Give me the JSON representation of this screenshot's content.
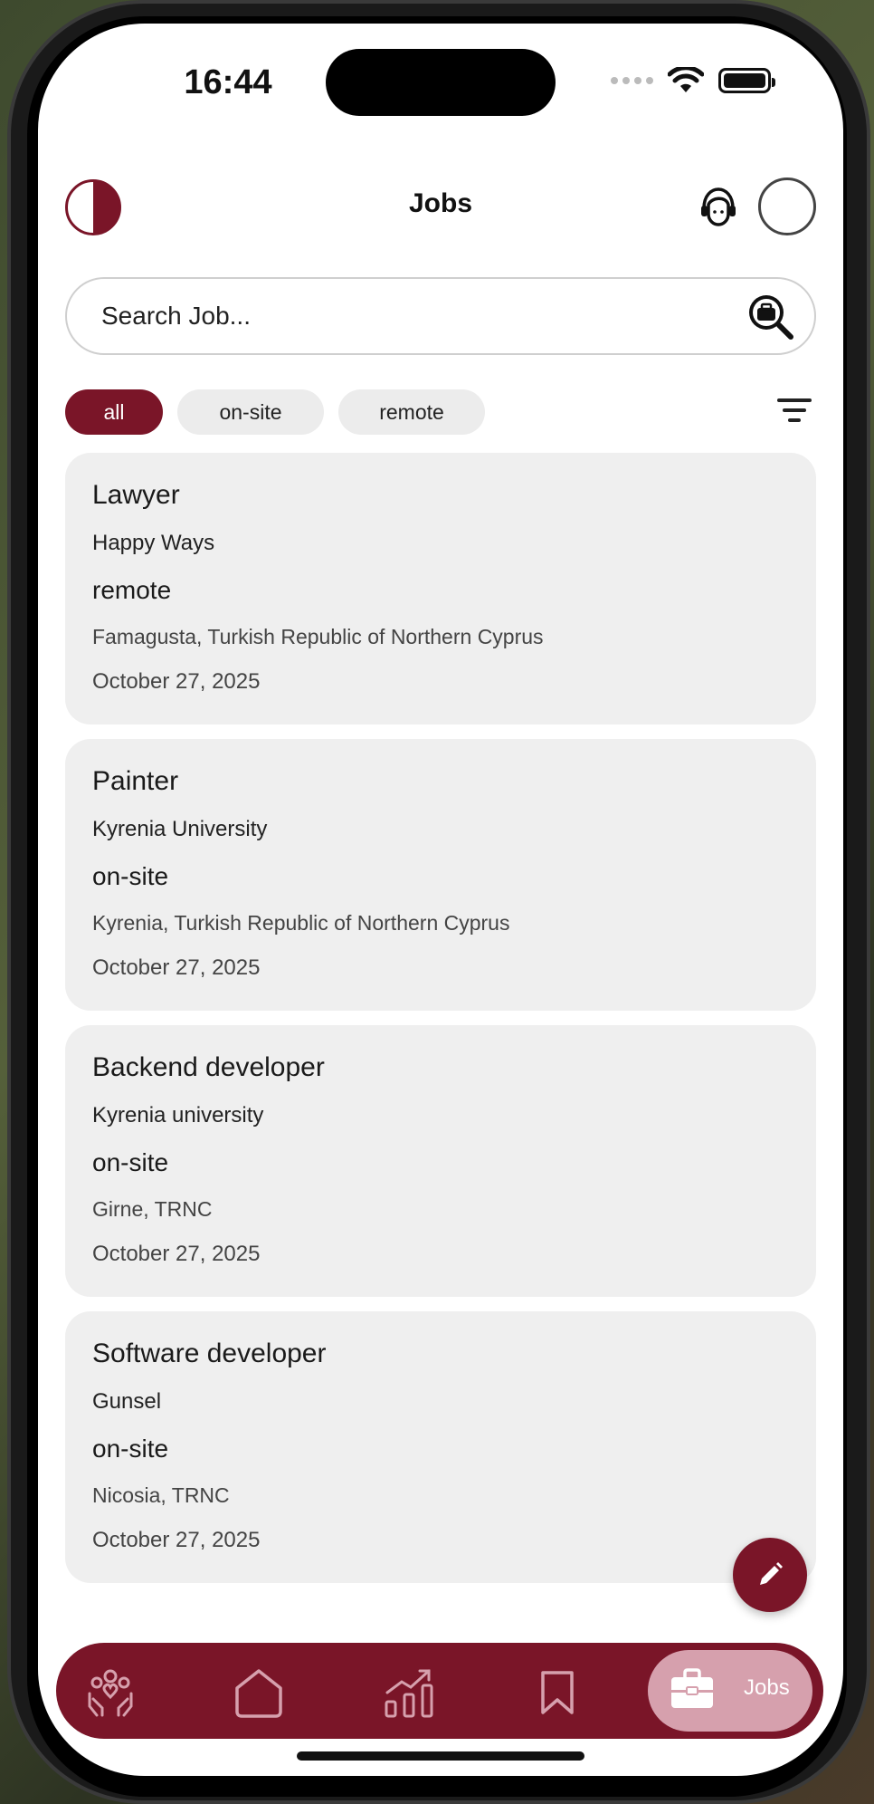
{
  "status_bar": {
    "time": "16:44"
  },
  "header": {
    "title": "Jobs"
  },
  "search": {
    "placeholder": "Search Job..."
  },
  "filters": [
    {
      "label": "all",
      "active": true
    },
    {
      "label": "on-site",
      "active": false
    },
    {
      "label": "remote",
      "active": false
    }
  ],
  "jobs": [
    {
      "title": "Lawyer",
      "company": "Happy Ways",
      "type": "remote",
      "location": "Famagusta, Turkish Republic of Northern Cyprus",
      "date": "October 27, 2025"
    },
    {
      "title": "Painter",
      "company": "Kyrenia University",
      "type": "on-site",
      "location": "Kyrenia, Turkish Republic of Northern Cyprus",
      "date": "October 27, 2025"
    },
    {
      "title": "Backend developer",
      "company": "Kyrenia university",
      "type": "on-site",
      "location": "Girne, TRNC",
      "date": "October 27, 2025"
    },
    {
      "title": "Software developer",
      "company": "Gunsel",
      "type": "on-site",
      "location": "Nicosia, TRNC",
      "date": "October 27, 2025"
    }
  ],
  "bottom_nav": {
    "items": [
      "community-icon",
      "home-icon",
      "stats-icon",
      "bookmark-icon",
      "briefcase-icon"
    ],
    "active_label": "Jobs"
  },
  "colors": {
    "brand": "#7a1528",
    "brand_light": "#d6a0ad",
    "card_bg": "#efefef"
  }
}
